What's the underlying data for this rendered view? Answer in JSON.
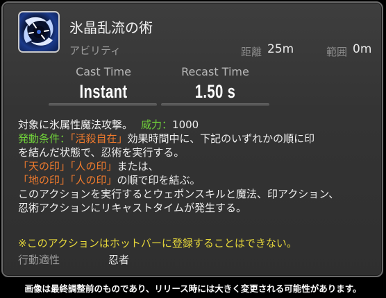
{
  "skill": {
    "name": "氷晶乱流の術",
    "type": "アビリティ",
    "icon": "ice-swirl-ninjutsu-icon",
    "range_label": "距離",
    "range_value": "25m",
    "radius_label": "範囲",
    "radius_value": "0m",
    "cast_time_label": "Cast Time",
    "cast_time_value": "Instant",
    "recast_time_label": "Recast Time",
    "recast_time_value": "1.50 s"
  },
  "description": {
    "line1_text": "対象に氷属性魔法攻撃。",
    "potency_label": "威力：",
    "potency_value": "1000",
    "condition_label": "発動条件：",
    "condition_status": "「活殺自在」",
    "condition_text": "効果時間中に、下記のいずれかの順に印",
    "line3": "を結んだ状態で、忍術を実行する。",
    "seal_heaven": "「天の印」",
    "seal_man_a": "「人の印」",
    "or_text": "または、",
    "seal_earth": "「地の印」",
    "seal_man_b": "「人の印」",
    "order_text": "の順で印を結ぶ。",
    "line6": "このアクションを実行するとウェポンスキルと魔法、印アクション、",
    "line7": "忍術アクションにリキャストタイムが発生する。"
  },
  "warning": "※このアクションはホットバーに登録することはできない。",
  "job": {
    "label": "行動適性",
    "value": "忍者"
  },
  "footer_note": "画像は最終調整前のものであり、リリース時には大きく変更される可能性があります。",
  "colors": {
    "green": "#6fcf3a",
    "orange": "#ef7a2d",
    "warning_yellow": "#e7d83a"
  }
}
